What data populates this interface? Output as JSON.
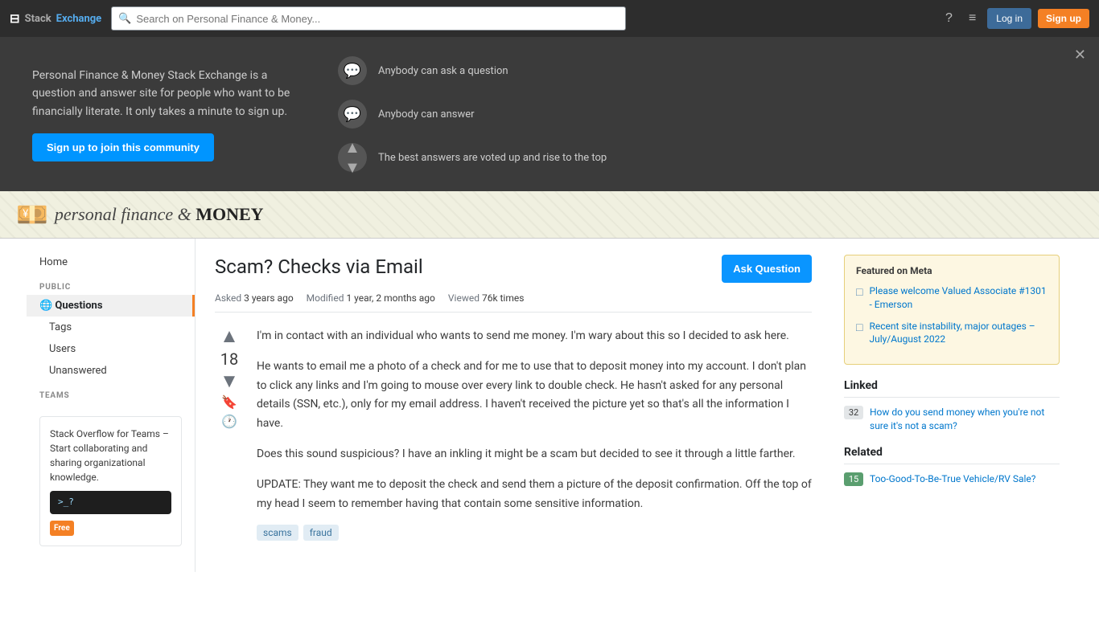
{
  "topnav": {
    "logo_stack": "Stack",
    "logo_exchange": "Exchange",
    "search_placeholder": "Search on Personal Finance & Money...",
    "login_label": "Log in",
    "signup_label": "Sign up"
  },
  "promo": {
    "description": "Personal Finance & Money Stack Exchange is a question and answer site for people who want to be financially literate. It only takes a minute to sign up.",
    "cta_label": "Sign up to join this community",
    "feature1": "Anybody can ask a question",
    "feature2": "Anybody can answer",
    "feature3": "The best answers are voted up and rise to the top"
  },
  "site": {
    "name_italic": "personal finance &",
    "name_bold": "MONEY"
  },
  "sidebar": {
    "home": "Home",
    "public_label": "PUBLIC",
    "questions_label": "Questions",
    "tags_label": "Tags",
    "users_label": "Users",
    "unanswered_label": "Unanswered",
    "teams_label": "TEAMS",
    "teams_title": "Stack Overflow for Teams",
    "teams_desc": "– Start collaborating and sharing organizational knowledge.",
    "free_badge": "Free"
  },
  "question": {
    "title": "Scam? Checks via Email",
    "ask_button": "Ask Question",
    "asked_label": "Asked",
    "asked_value": "3 years ago",
    "modified_label": "Modified",
    "modified_value": "1 year, 2 months ago",
    "viewed_label": "Viewed",
    "viewed_value": "76k times",
    "vote_count": "18",
    "body_p1": "I'm in contact with an individual who wants to send me money. I'm wary about this so I decided to ask here.",
    "body_p2": "He wants to email me a photo of a check and for me to use that to deposit money into my account. I don't plan to click any links and I'm going to mouse over every link to double check. He hasn't asked for any personal details (SSN, etc.), only for my email address. I haven't received the picture yet so that's all the information I have.",
    "body_p3": "Does this sound suspicious? I have an inkling it might be a scam but decided to see it through a little farther.",
    "body_p4": "UPDATE: They want me to deposit the check and send them a picture of the deposit confirmation. Off the top of my head I seem to remember having that contain some sensitive information.",
    "tag1": "scams",
    "tag2": "fraud"
  },
  "featured_meta": {
    "title": "Featured on Meta",
    "item1": "Please welcome Valued Associate #1301 - Emerson",
    "item2": "Recent site instability, major outages – July/August 2022"
  },
  "linked": {
    "title": "Linked",
    "item1_score": "32",
    "item1_text": "How do you send money when you're not sure it's not a scam?"
  },
  "related": {
    "title": "Related",
    "item1_score": "15",
    "item1_text": "Too-Good-To-Be-True Vehicle/RV Sale?"
  }
}
